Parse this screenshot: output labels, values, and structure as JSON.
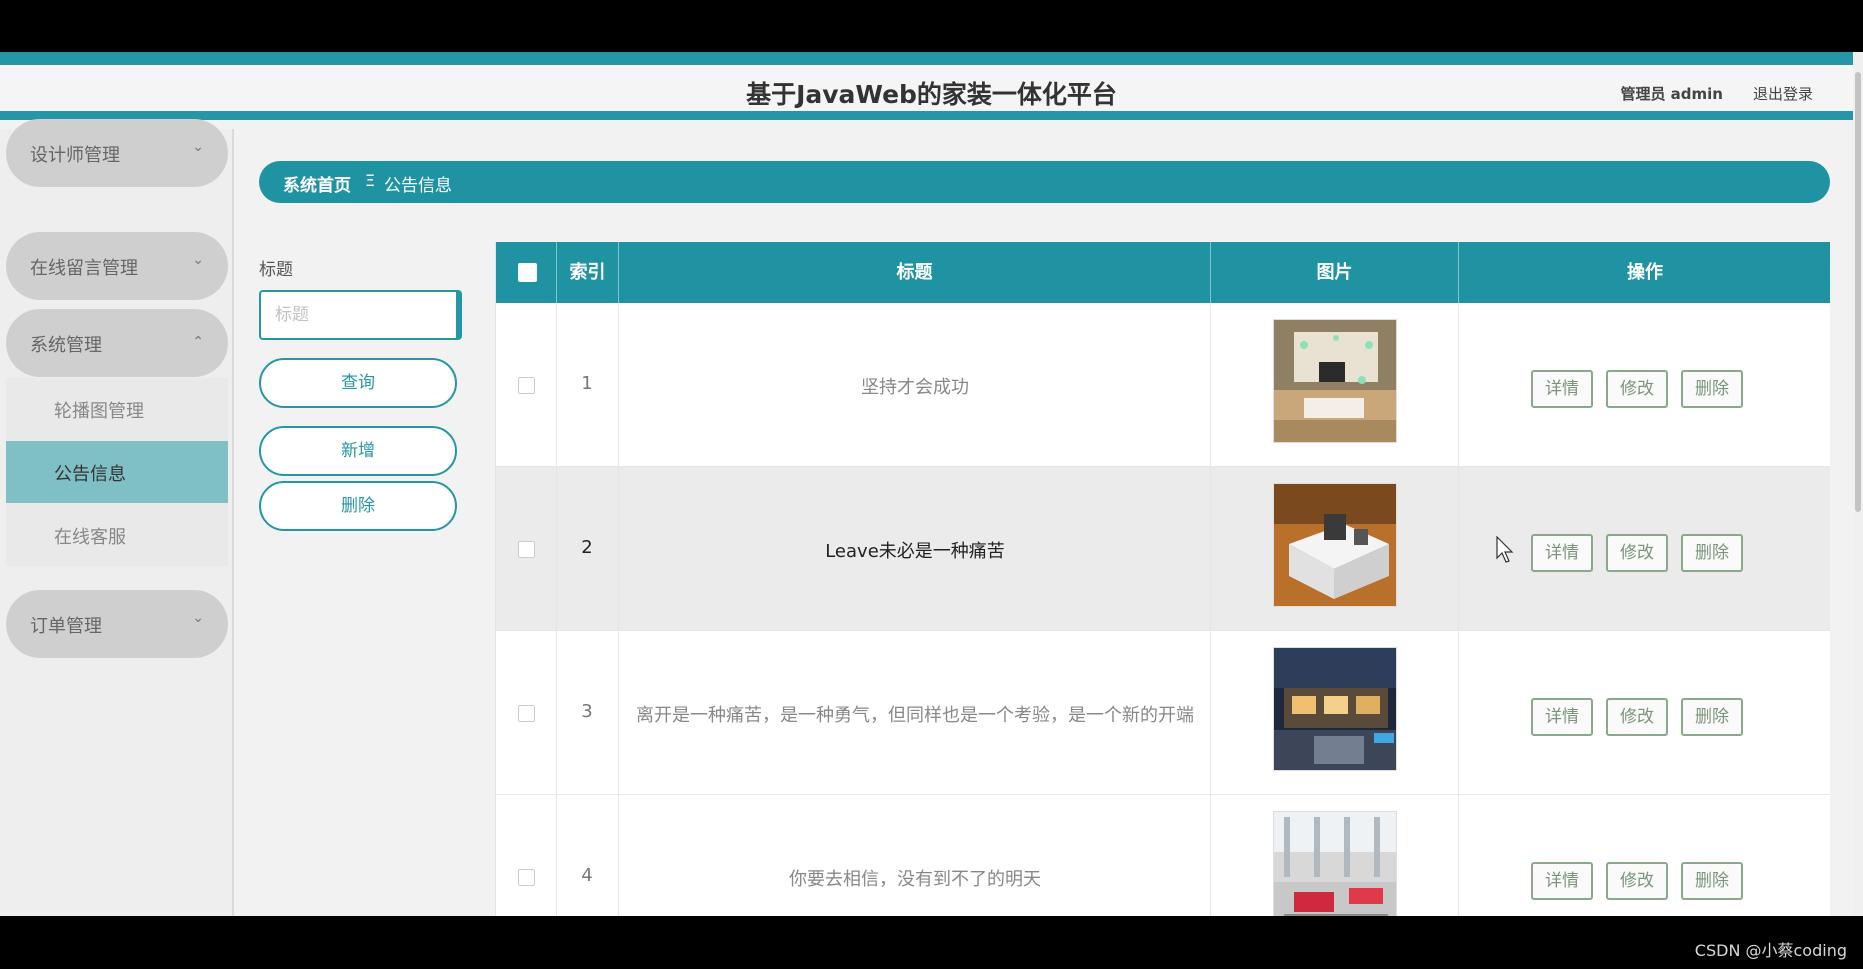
{
  "header": {
    "title": "基于JavaWeb的家装一体化平台",
    "user": "管理员 admin",
    "logout": "退出登录"
  },
  "sidebar": {
    "groups": [
      {
        "label": "设计师管理",
        "chevron": "chevron-down"
      },
      {
        "label": "在线留言管理",
        "chevron": "chevron-down"
      },
      {
        "label": "系统管理",
        "chevron": "chevron-up"
      },
      {
        "label": "订单管理",
        "chevron": "chevron-down"
      }
    ],
    "sub_items": [
      {
        "label": "轮播图管理"
      },
      {
        "label": "公告信息",
        "active": true
      },
      {
        "label": "在线客服"
      }
    ]
  },
  "breadcrumb": {
    "home": "系统首页",
    "separator": "Ξ",
    "current": "公告信息"
  },
  "filter": {
    "label": "标题",
    "placeholder": "标题",
    "value": "",
    "query_button": "查询",
    "add_button": "新增",
    "delete_button": "删除"
  },
  "table": {
    "columns": [
      "索引",
      "标题",
      "图片",
      "操作"
    ],
    "rows": [
      {
        "index": "1",
        "title": "坚持才会成功",
        "image": "living-room-photo"
      },
      {
        "index": "2",
        "title": "Leave未必是一种痛苦",
        "image": "kitchen-island-photo"
      },
      {
        "index": "3",
        "title": "离开是一种痛苦，是一种勇气，但同样也是一个考验，是一个新的开端",
        "image": "villa-exterior-photo"
      },
      {
        "index": "4",
        "title": "你要去相信，没有到不了的明天",
        "image": "dining-room-photo"
      }
    ],
    "actions": {
      "detail": "详情",
      "edit": "修改",
      "delete": "删除"
    }
  },
  "watermark": "CSDN @小蔡coding",
  "colors": {
    "accent": "#2596a5",
    "active_menu": "#7fc0c7"
  }
}
